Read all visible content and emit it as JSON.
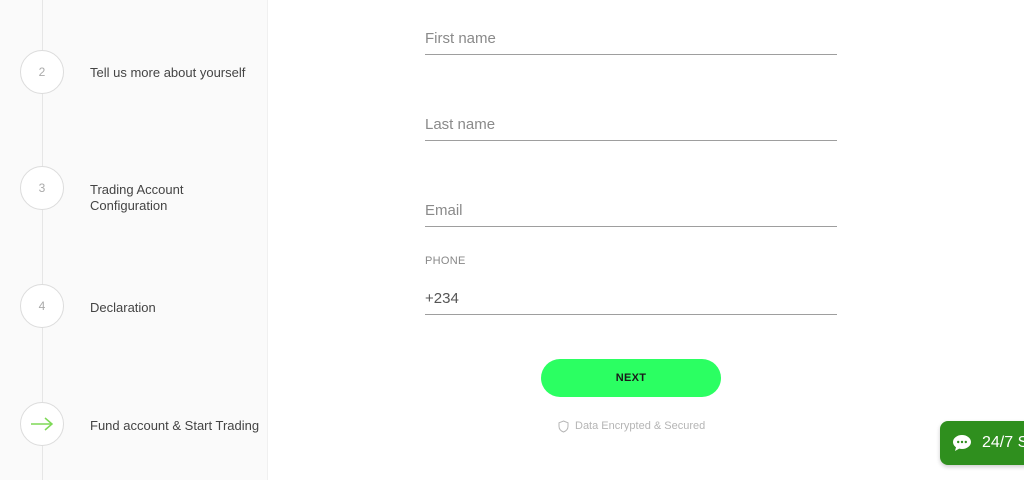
{
  "steps": [
    {
      "number": "2",
      "label": "Tell us more about yourself"
    },
    {
      "number": "3",
      "label": "Trading Account Configuration"
    },
    {
      "number": "4",
      "label": "Declaration"
    },
    {
      "number": "",
      "label": "Fund account & Start Trading",
      "icon": "arrow-right-icon"
    }
  ],
  "form": {
    "first_name_placeholder": "First name",
    "last_name_placeholder": "Last name",
    "email_placeholder": "Email",
    "phone_label": "PHONE",
    "phone_value": "+234",
    "next_label": "NEXT",
    "secure_text": "Data Encrypted & Secured"
  },
  "chat": {
    "label": "24/7 S"
  },
  "colors": {
    "accent": "#2bff62",
    "chat": "#2f8f1e",
    "arrow": "#7ed957"
  }
}
